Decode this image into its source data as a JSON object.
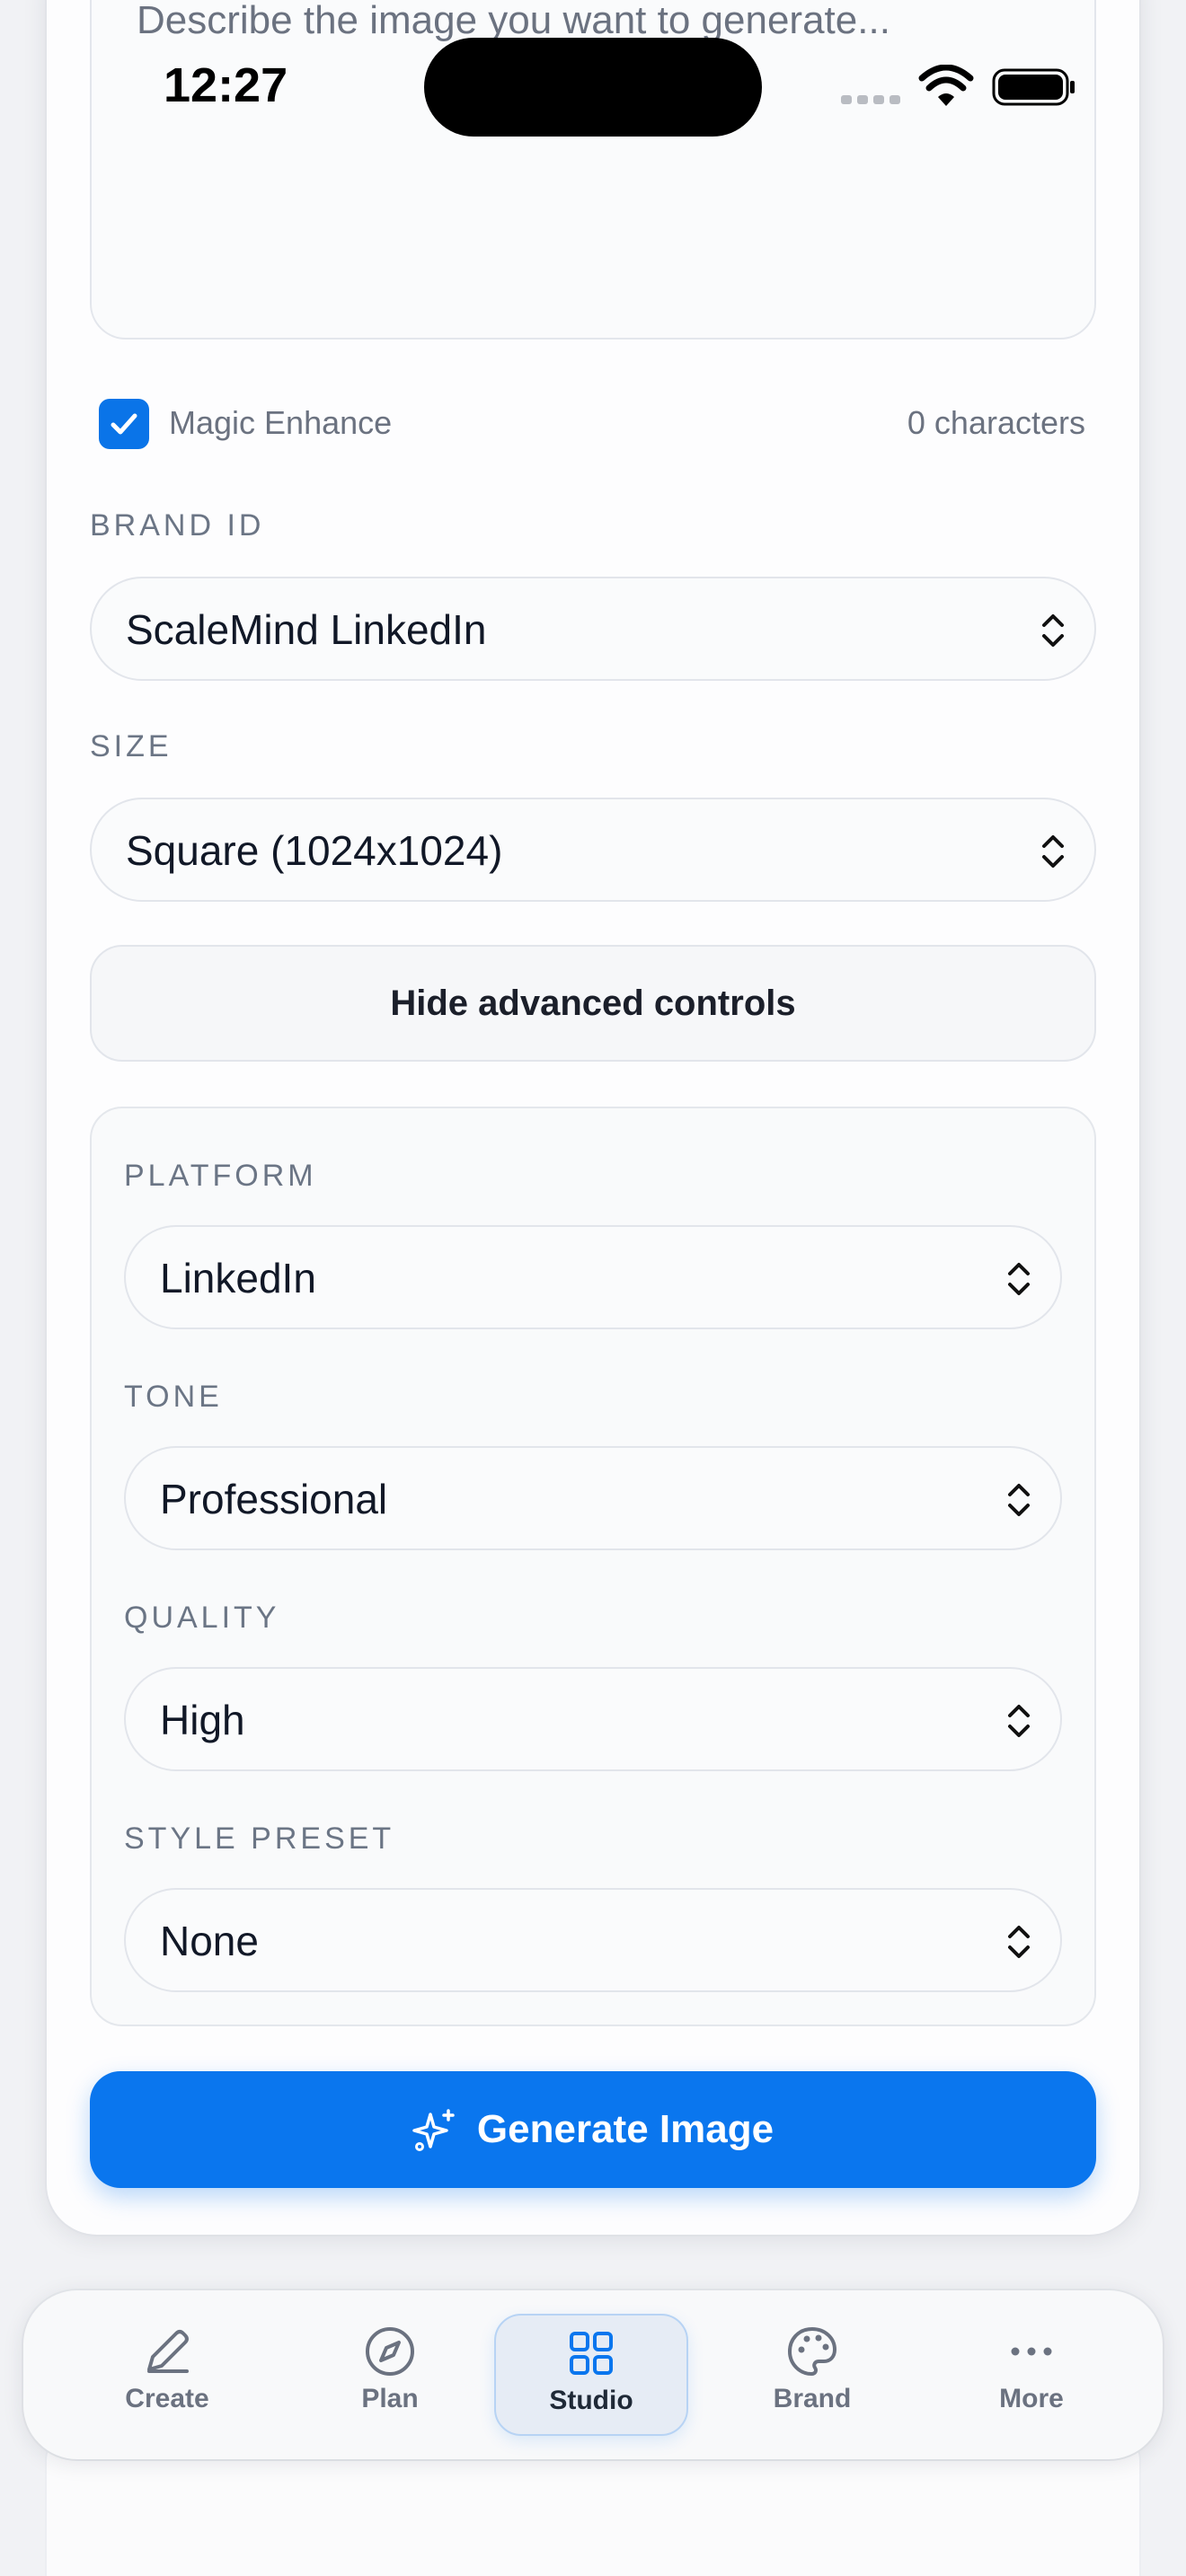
{
  "status_bar": {
    "time": "12:27"
  },
  "prompt": {
    "placeholder": "Describe the image you want to generate..."
  },
  "magic_enhance": {
    "label": "Magic Enhance",
    "checked": true,
    "char_count": "0 characters"
  },
  "brand_id": {
    "label": "BRAND ID",
    "value": "ScaleMind LinkedIn"
  },
  "size": {
    "label": "SIZE",
    "value": "Square (1024x1024)"
  },
  "advanced_toggle": {
    "label": "Hide advanced controls"
  },
  "advanced": {
    "platform": {
      "label": "PLATFORM",
      "value": "LinkedIn"
    },
    "tone": {
      "label": "TONE",
      "value": "Professional"
    },
    "quality": {
      "label": "QUALITY",
      "value": "High"
    },
    "style_preset": {
      "label": "STYLE PRESET",
      "value": "None"
    }
  },
  "generate_button": {
    "label": "Generate Image",
    "icon": "sparkles-icon"
  },
  "nav": {
    "active": "Studio",
    "accent": "#0a76ee",
    "items": [
      {
        "label": "Create",
        "icon": "pencil-icon"
      },
      {
        "label": "Plan",
        "icon": "compass-icon"
      },
      {
        "label": "Studio",
        "icon": "grid-icon"
      },
      {
        "label": "Brand",
        "icon": "palette-icon"
      },
      {
        "label": "More",
        "icon": "more-icon"
      }
    ]
  }
}
